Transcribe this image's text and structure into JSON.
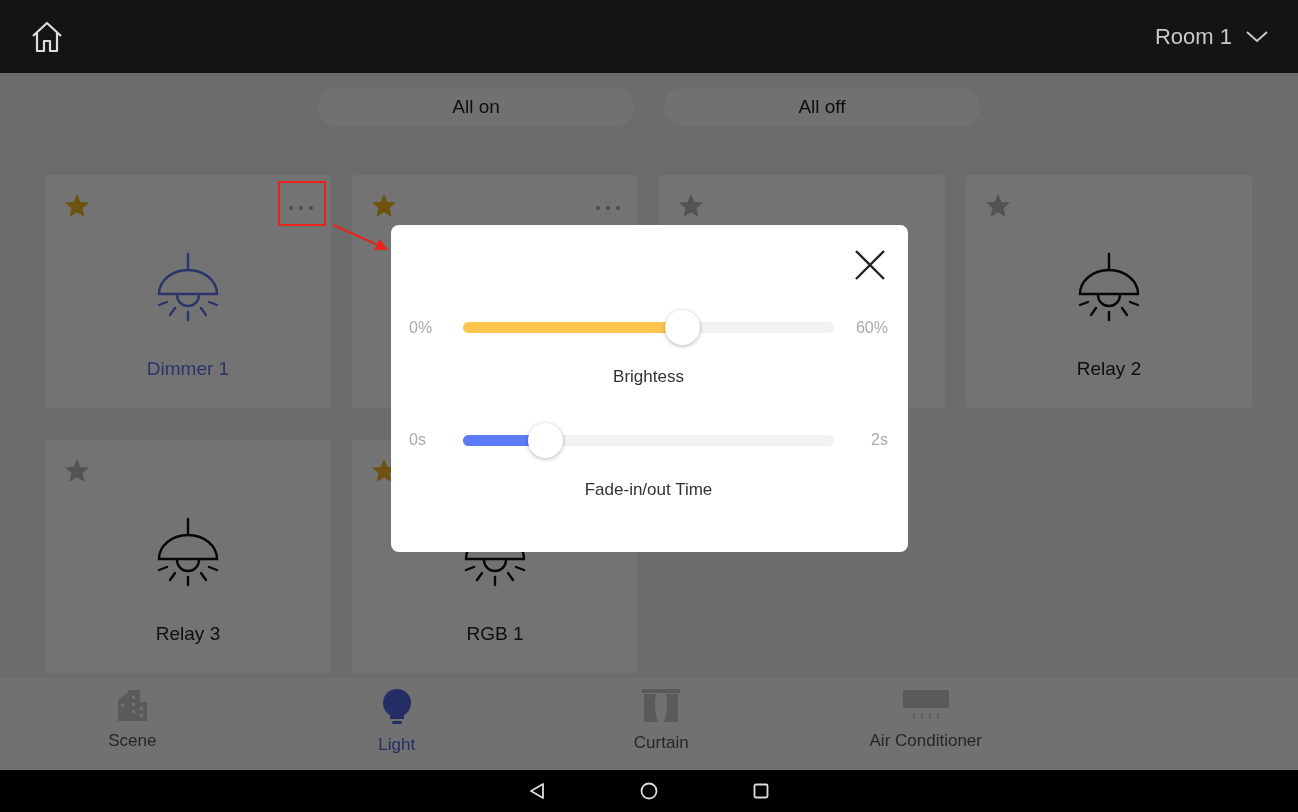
{
  "header": {
    "room": "Room 1"
  },
  "actions": [
    "All on",
    "All off"
  ],
  "devices": [
    {
      "name": "Dimmer 1",
      "favorite": true,
      "on": true,
      "menu": true
    },
    {
      "favorite": true,
      "menu": true
    },
    {
      "favorite": false
    },
    {
      "name": "Relay 2",
      "favorite": false,
      "on": false
    },
    {
      "name": "Relay 3",
      "favorite": false,
      "on": false
    },
    {
      "name": "RGB 1",
      "favorite": true,
      "on": false
    }
  ],
  "dialog": {
    "sliders": [
      {
        "min": "0%",
        "max": "60%",
        "label": "Brightess",
        "level": 0.59,
        "color": "#fcc54c"
      },
      {
        "min": "0s",
        "max": "2s",
        "label": "Fade-in/out Time",
        "level": 0.22,
        "color": "#5b7cf6"
      }
    ]
  },
  "tabs": [
    {
      "label": "Scene",
      "kind": "scene",
      "selected": false
    },
    {
      "label": "Light",
      "kind": "light",
      "selected": true
    },
    {
      "label": "Curtain",
      "kind": "curtain",
      "selected": false
    },
    {
      "label": "Air Conditioner",
      "kind": "ac",
      "selected": false
    }
  ]
}
